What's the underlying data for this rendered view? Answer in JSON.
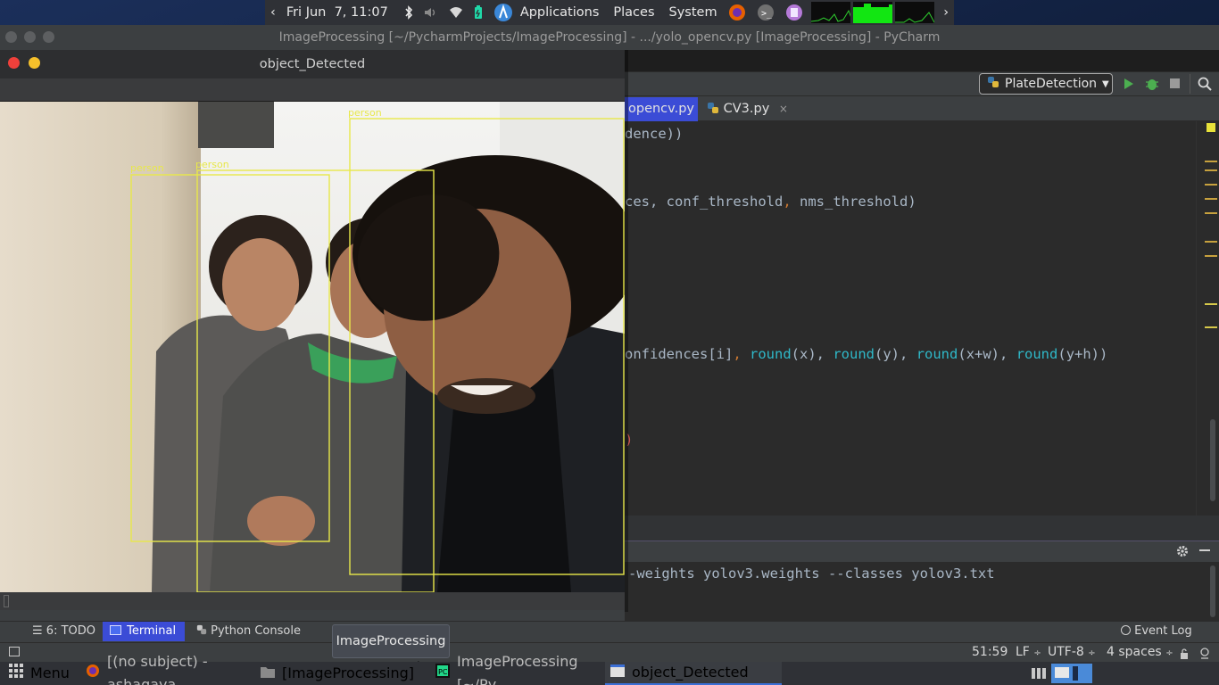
{
  "top_panel": {
    "datetime": "Fri Jun  7, 11:07",
    "menus": [
      "Applications",
      "Places",
      "System"
    ]
  },
  "pycharm": {
    "window_title": "ImageProcessing [~/PycharmProjects/ImageProcessing] - .../yolo_opencv.py [ImageProcessing] - PyCharm",
    "run_config": "PlateDetection",
    "tabs": [
      "opencv.py",
      "CV3.py"
    ],
    "code_lines": {
      "line1": "dence))",
      "line2_a": "ces, ",
      "line2_b": "conf_threshold",
      "line2_c": ", ",
      "line2_d": "nms_threshold)",
      "line3_a": "onfidences[i]",
      "line3_b": ", ",
      "line3_round1": "round",
      "line3_c": "(x), ",
      "line3_round2": "round",
      "line3_d": "(y), ",
      "line3_round3": "round",
      "line3_e": "(x+w), ",
      "line3_round4": "round",
      "line3_f": "(y+h))",
      "line4": ")"
    },
    "terminal_text": "-weights yolov3.weights --classes yolov3.txt",
    "tool_tabs": {
      "todo": "6: TODO",
      "terminal": "Terminal",
      "python_console": "Python Console",
      "event_log": "Event Log"
    },
    "status": {
      "position": "51:59",
      "line_sep": "LF",
      "encoding": "UTF-8",
      "indent": "4 spaces"
    }
  },
  "object_window": {
    "title": "object_Detected",
    "labels": [
      "person",
      "person",
      "person"
    ]
  },
  "tooltip": "ImageProcessing",
  "taskbar": {
    "menu": "Menu",
    "items": [
      "[(no subject) - ashagaya...",
      "[ImageProcessing]",
      "ImageProcessing [~/Py...",
      "object_Detected"
    ]
  }
}
